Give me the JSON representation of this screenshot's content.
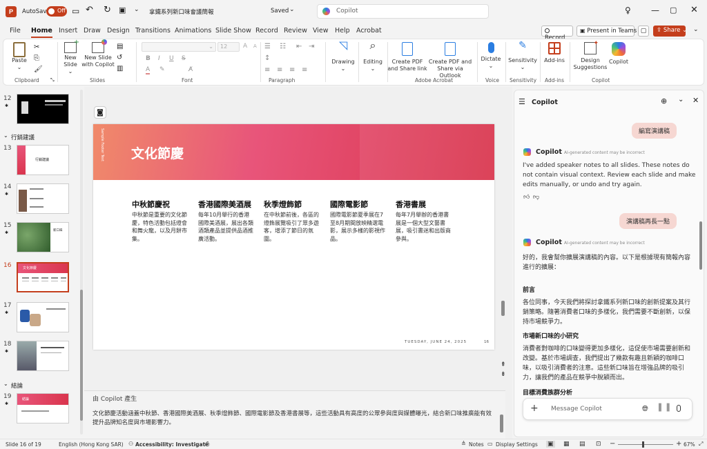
{
  "titlebar": {
    "autosave": "AutoSave",
    "toggle": "Off",
    "filename": "拿鐵系列新口味會議簡報",
    "saved": "Saved",
    "search": "Copilot"
  },
  "tabs": [
    "File",
    "Home",
    "Insert",
    "Draw",
    "Design",
    "Transitions",
    "Animations",
    "Slide Show",
    "Record",
    "Review",
    "View",
    "Help",
    "Acrobat"
  ],
  "actions": {
    "record": "Record",
    "present": "Present in Teams",
    "share": "Share"
  },
  "ribbon": {
    "clipboard": {
      "label": "Clipboard",
      "paste": "Paste"
    },
    "slides": {
      "label": "Slides",
      "new_slide": [
        "New",
        "Slide"
      ],
      "copilot_slide": [
        "New Slide",
        "with Copilot"
      ]
    },
    "font": {
      "label": "Font",
      "size": "12"
    },
    "paragraph": {
      "label": "Paragraph"
    },
    "drawing": {
      "label": "Drawing"
    },
    "editing": {
      "label": "Editing"
    },
    "acrobat": {
      "label": "Adobe Acrobat",
      "pdf1": [
        "Create PDF",
        "and Share link"
      ],
      "pdf2": [
        "Create PDF and",
        "Share via Outlook"
      ]
    },
    "voice": {
      "label": "Voice",
      "dictate": "Dictate"
    },
    "sensitivity": {
      "label": "Sensitivity",
      "btn": "Sensitivity"
    },
    "addins": {
      "label": "Add-ins",
      "btn": "Add-ins"
    },
    "copilot": {
      "label": "Copilot",
      "design": [
        "Design",
        "Suggestions"
      ],
      "btn": "Copilot"
    }
  },
  "thumbs": {
    "section1": "行銷建議",
    "section2": "結論",
    "items": [
      {
        "n": "12",
        "title": ""
      },
      {
        "n": "13",
        "title": "行銷建議"
      },
      {
        "n": "14",
        "title": ""
      },
      {
        "n": "15",
        "title": "新口味"
      },
      {
        "n": "16",
        "title": "文化節慶"
      },
      {
        "n": "17",
        "title": ""
      },
      {
        "n": "18",
        "title": ""
      },
      {
        "n": "19",
        "title": "結論"
      }
    ]
  },
  "slide": {
    "title": "文化節慶",
    "side": "Sample Footer Text",
    "footer_date": "TUESDAY, JUNE 24, 2025",
    "footer_num": "16",
    "cols": [
      {
        "h": "中秋節慶祝",
        "t": "中秋節是重要的文化節慶，特色活動包括燈會和舞火龍，以及月餅市集。"
      },
      {
        "h": "香港國際美酒展",
        "t": "每年10月舉行的香港國際美酒展，展出各類酒類產品並提供品酒推廣活動。"
      },
      {
        "h": "秋季燈飾節",
        "t": "在中秋節前後，各區的燈飾展覽吸引了眾多遊客，增添了節日的氛圍。"
      },
      {
        "h": "國際電影節",
        "t": "國際電影節夏季展在7至8月期間放映精選電影，展示多樣的影視作品。"
      },
      {
        "h": "香港書展",
        "t": "每年7月舉辦的香港書展是一個大型文藝書展，吸引書迷和出版商參與。"
      }
    ]
  },
  "notes": {
    "label": "由 Copilot 產生",
    "text": "文化節慶活動涵蓋中秋節、香港國際美酒展、秋季燈飾節、國際電影節及香港書展等，這些活動具有高度的公眾參與度與媒體曝光，結合新口味推廣能有效提升品牌知名度與市場影響力。"
  },
  "copilot": {
    "title": "Copilot",
    "name": "Copilot",
    "disclaimer": "AI-generated content may be incorrect",
    "user1": "編寫演講稿",
    "reply1": "I've added speaker notes to all slides. These notes do not contain visual context. Review each slide and make edits manually, or undo and try again.",
    "user2": "演講稿再長一點",
    "reply2_intro": "好的，我會幫你擴展演講稿的內容。以下是根據現有簡報內容進行的擴展：",
    "h1": "前言",
    "p1": "各位同事，今天我們將探討拿鐵系列新口味的創新提案及其行銷策略。隨著消費者口味的多樣化，我們需要不斷創新，以保持市場競爭力。",
    "h2": "市場新口味的小研究",
    "p2": "消費者對咖啡的口味變得更加多樣化，這促使市場需要創新和改變。基於市場調查，我們提出了幾款有趣且新穎的咖啡口味，以吸引消費者的注意。這些新口味旨在增強品牌的吸引力，讓我們的產品在競爭中脫穎而出。",
    "h3": "目標消費族群分析",
    "placeholder": "Message Copilot"
  },
  "status": {
    "slide": "Slide 16 of 19",
    "lang": "English (Hong Kong SAR)",
    "access": "Accessibility: Investigate",
    "notes": "Notes",
    "display": "Display Settings",
    "zoom": "67%"
  },
  "colors": {
    "accent": "#c43e1c",
    "slide_grad_start": "#e8557a",
    "slide_grad_end": "#d9344c"
  }
}
